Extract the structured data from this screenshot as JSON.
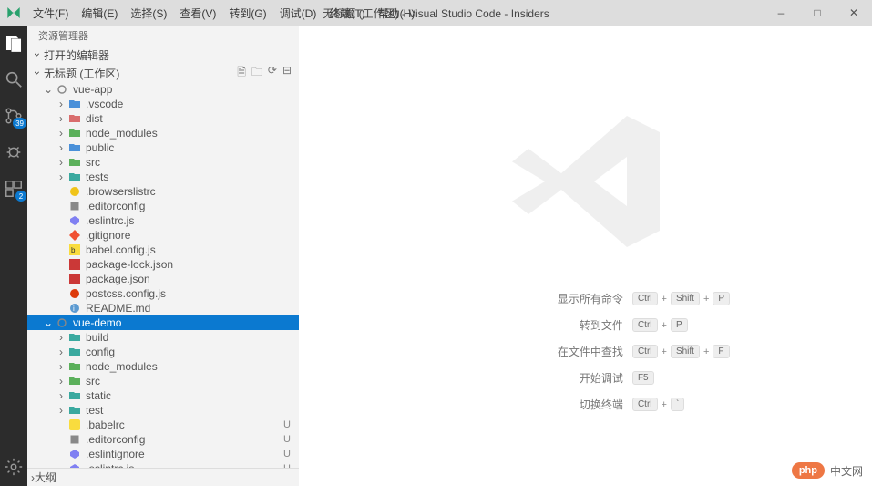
{
  "title": "无标题 (工作区) - Visual Studio Code - Insiders",
  "menu": [
    "文件(F)",
    "编辑(E)",
    "选择(S)",
    "查看(V)",
    "转到(G)",
    "调试(D)",
    "终端(T)",
    "帮助(H)"
  ],
  "activity": {
    "items": [
      {
        "name": "explorer",
        "active": true,
        "badge": null
      },
      {
        "name": "search",
        "active": false,
        "badge": null
      },
      {
        "name": "scm",
        "active": false,
        "badge": "39"
      },
      {
        "name": "debug",
        "active": false,
        "badge": null
      },
      {
        "name": "extensions",
        "active": false,
        "badge": "2"
      }
    ],
    "bottom": {
      "name": "settings"
    }
  },
  "sidebar": {
    "title": "资源管理器",
    "openEditors": "打开的编辑器",
    "workspace": "无标题 (工作区)",
    "outline": "大纲"
  },
  "tree": [
    {
      "d": 0,
      "exp": true,
      "kind": "root",
      "icon": "circle",
      "name": "vue-app",
      "status": "",
      "dot": "green"
    },
    {
      "d": 1,
      "exp": false,
      "kind": "folder",
      "icon": "folder-blue",
      "name": ".vscode"
    },
    {
      "d": 1,
      "exp": false,
      "kind": "folder",
      "icon": "folder-red",
      "name": "dist"
    },
    {
      "d": 1,
      "exp": false,
      "kind": "folder",
      "icon": "folder-green",
      "name": "node_modules"
    },
    {
      "d": 1,
      "exp": false,
      "kind": "folder",
      "icon": "folder-blue",
      "name": "public"
    },
    {
      "d": 1,
      "exp": false,
      "kind": "folder",
      "icon": "folder-green",
      "name": "src",
      "dot": "amber"
    },
    {
      "d": 1,
      "exp": false,
      "kind": "folder",
      "icon": "folder-teal",
      "name": "tests"
    },
    {
      "d": 1,
      "kind": "file",
      "icon": "browsers",
      "name": ".browserslistrc"
    },
    {
      "d": 1,
      "kind": "file",
      "icon": "editorconfig",
      "name": ".editorconfig"
    },
    {
      "d": 1,
      "kind": "file",
      "icon": "eslint",
      "name": ".eslintrc.js"
    },
    {
      "d": 1,
      "kind": "file",
      "icon": "git",
      "name": ".gitignore"
    },
    {
      "d": 1,
      "kind": "file",
      "icon": "babel",
      "name": "babel.config.js"
    },
    {
      "d": 1,
      "kind": "file",
      "icon": "npm",
      "name": "package-lock.json"
    },
    {
      "d": 1,
      "kind": "file",
      "icon": "npm",
      "name": "package.json"
    },
    {
      "d": 1,
      "kind": "file",
      "icon": "postcss",
      "name": "postcss.config.js"
    },
    {
      "d": 1,
      "kind": "file",
      "icon": "readme",
      "name": "README.md"
    },
    {
      "d": 0,
      "exp": true,
      "kind": "root",
      "icon": "circle",
      "name": "vue-demo",
      "sel": true,
      "dot": "amber"
    },
    {
      "d": 1,
      "exp": false,
      "kind": "folder",
      "icon": "folder-teal",
      "name": "build",
      "dot": "amber"
    },
    {
      "d": 1,
      "exp": false,
      "kind": "folder",
      "icon": "folder-teal",
      "name": "config",
      "dot": "amber"
    },
    {
      "d": 1,
      "exp": false,
      "kind": "folder",
      "icon": "folder-green",
      "name": "node_modules"
    },
    {
      "d": 1,
      "exp": false,
      "kind": "folder",
      "icon": "folder-green",
      "name": "src",
      "dot": "amber"
    },
    {
      "d": 1,
      "exp": false,
      "kind": "folder",
      "icon": "folder-teal",
      "name": "static",
      "dot": "amber"
    },
    {
      "d": 1,
      "exp": false,
      "kind": "folder",
      "icon": "folder-teal",
      "name": "test",
      "dot": "amber"
    },
    {
      "d": 1,
      "kind": "file",
      "icon": "babel2",
      "name": ".babelrc",
      "status": "U"
    },
    {
      "d": 1,
      "kind": "file",
      "icon": "editorconfig",
      "name": ".editorconfig",
      "status": "U"
    },
    {
      "d": 1,
      "kind": "file",
      "icon": "eslint",
      "name": ".eslintignore",
      "status": "U"
    },
    {
      "d": 1,
      "kind": "file",
      "icon": "eslint",
      "name": ".eslintrc.js",
      "status": "U"
    }
  ],
  "welcome": {
    "commands": [
      {
        "label": "显示所有命令",
        "keys": [
          "Ctrl",
          "+",
          "Shift",
          "+",
          "P"
        ]
      },
      {
        "label": "转到文件",
        "keys": [
          "Ctrl",
          "+",
          "P"
        ]
      },
      {
        "label": "在文件中查找",
        "keys": [
          "Ctrl",
          "+",
          "Shift",
          "+",
          "F"
        ]
      },
      {
        "label": "开始调试",
        "keys": [
          "F5"
        ]
      },
      {
        "label": "切换终端",
        "keys": [
          "Ctrl",
          "+",
          "`"
        ]
      }
    ]
  },
  "watermark": {
    "pill": "php",
    "text": "中文网"
  }
}
